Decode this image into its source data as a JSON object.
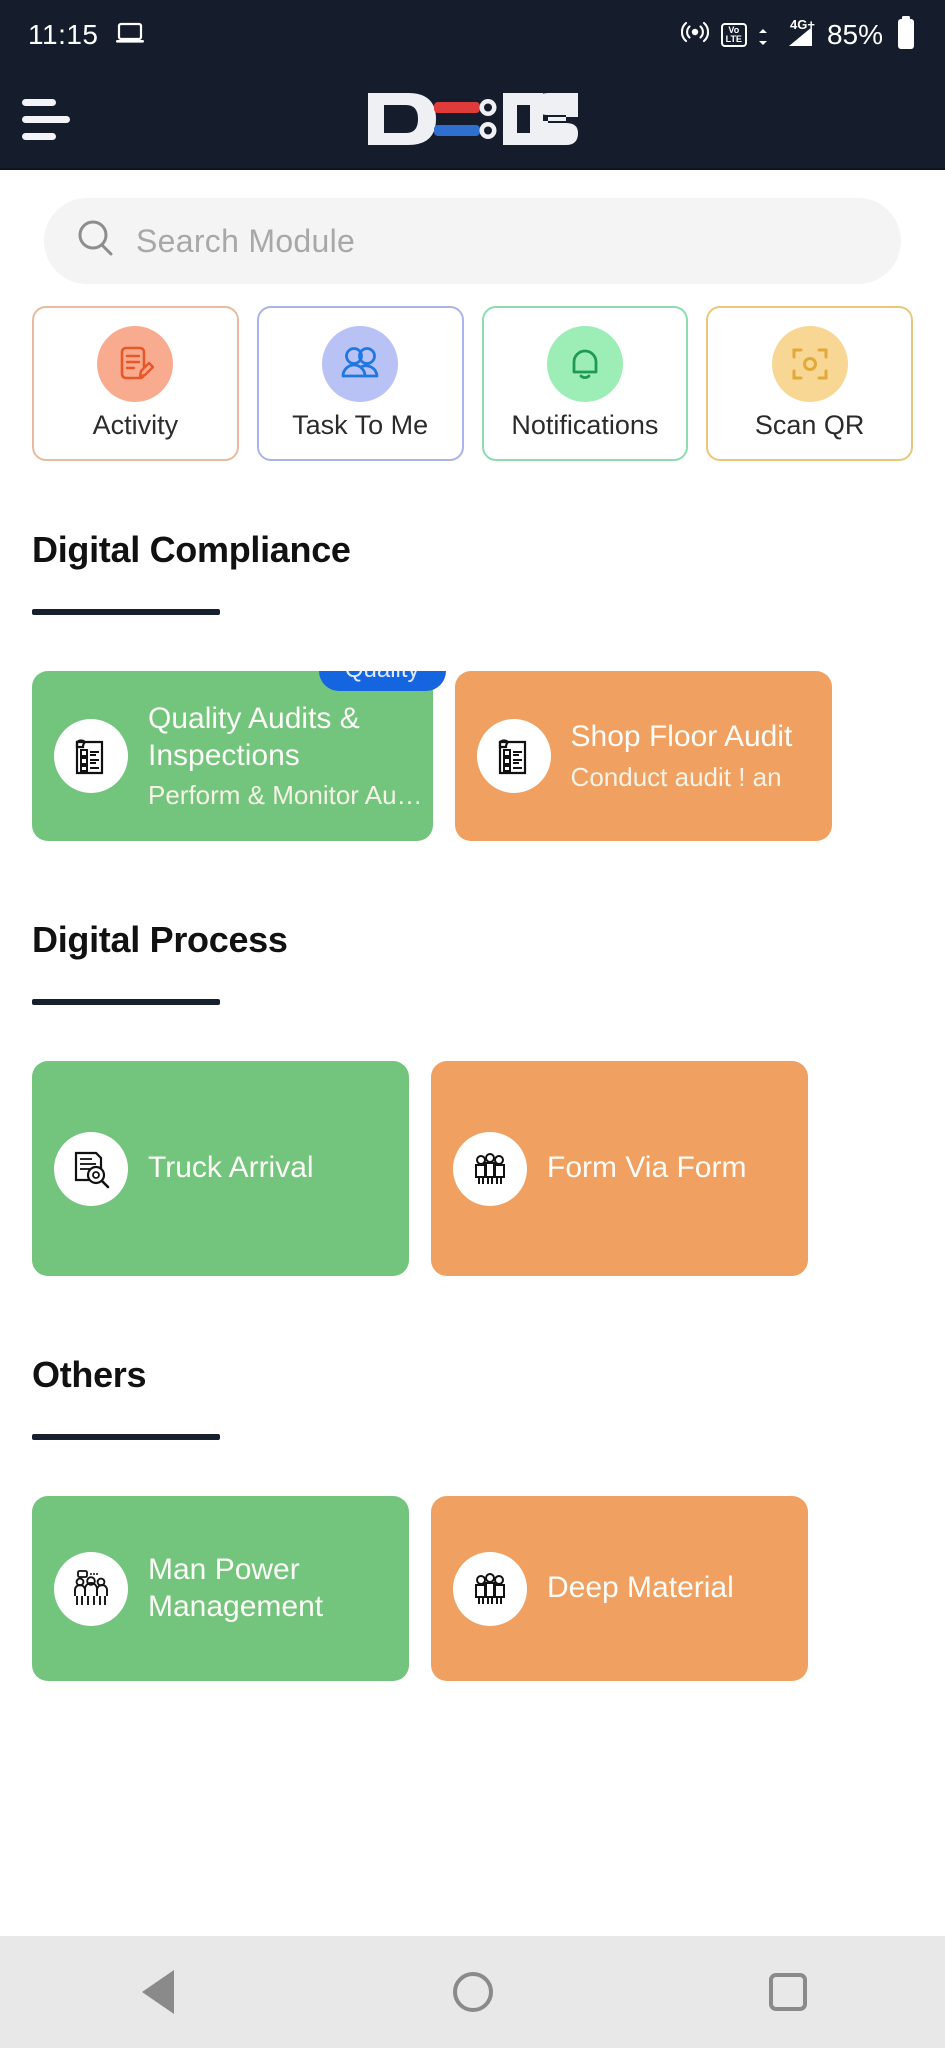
{
  "status_bar": {
    "time": "11:15",
    "cast_icon": "laptop-icon",
    "hotspot_icon": "hotspot-icon",
    "volte_top": "Vo",
    "volte_bottom": "LTE",
    "network_label": "4G+",
    "signal_icon": "signal-bars-icon",
    "battery_percent": "85%",
    "battery_icon": "battery-icon"
  },
  "header": {
    "menu_icon": "hamburger-menu-icon",
    "logo_text": "DOS",
    "logo_alt": "D-OS",
    "logo_accent_red": "#e03b3b",
    "logo_accent_blue": "#2f6fd0",
    "background": "#151c2c"
  },
  "search": {
    "placeholder": "Search Module",
    "icon": "search-icon",
    "value": ""
  },
  "quick_actions": [
    {
      "label": "Activity",
      "icon": "note-edit-icon",
      "circle_color": "#f9ab8f",
      "border_color": "#e9b9a2",
      "glyph_color": "#e8572a"
    },
    {
      "label": "Task To Me",
      "icon": "people-icon",
      "circle_color": "#b9c2f5",
      "border_color": "#aab4ec",
      "glyph_color": "#1f78e0"
    },
    {
      "label": "Notifications",
      "icon": "bell-icon",
      "circle_color": "#9ceeb6",
      "border_color": "#8ddcae",
      "glyph_color": "#1f9a52"
    },
    {
      "label": "Scan QR",
      "icon": "qr-scan-icon",
      "circle_color": "#f7d793",
      "border_color": "#e9c77f",
      "glyph_color": "#e0a93a"
    }
  ],
  "sections": [
    {
      "title": "Digital Compliance",
      "cards": [
        {
          "title": "Quality Audits &\nInspections",
          "subtitle": "Perform & Monitor Au…",
          "badge": "Quality",
          "color": "green",
          "icon": "checklist-clipboard-icon"
        },
        {
          "title": "Shop Floor Audit",
          "subtitle": "Conduct audit ! an",
          "badge": "",
          "color": "orange",
          "icon": "checklist-clipboard-icon"
        }
      ]
    },
    {
      "title": "Digital Process",
      "cards": [
        {
          "title": "Truck Arrival",
          "subtitle": "",
          "badge": "",
          "color": "green",
          "icon": "document-search-icon"
        },
        {
          "title": "Form Via Form",
          "subtitle": "",
          "badge": "",
          "color": "orange",
          "icon": "group-people-icon"
        }
      ]
    },
    {
      "title": "Others",
      "cards": [
        {
          "title": "Man Power\nManagement",
          "subtitle": "",
          "badge": "",
          "color": "green",
          "icon": "team-meeting-icon"
        },
        {
          "title": "Deep Material",
          "subtitle": "",
          "badge": "",
          "color": "orange",
          "icon": "group-people-icon"
        }
      ]
    }
  ],
  "nav_bar": {
    "back_icon": "back-triangle-icon",
    "home_icon": "home-circle-icon",
    "recents_icon": "recents-square-icon",
    "background": "#e8e8e8"
  },
  "theme": {
    "green_card": "#73c47c",
    "orange_card": "#f0a061",
    "badge_blue": "#1565e0",
    "header_dark": "#151c2c"
  }
}
